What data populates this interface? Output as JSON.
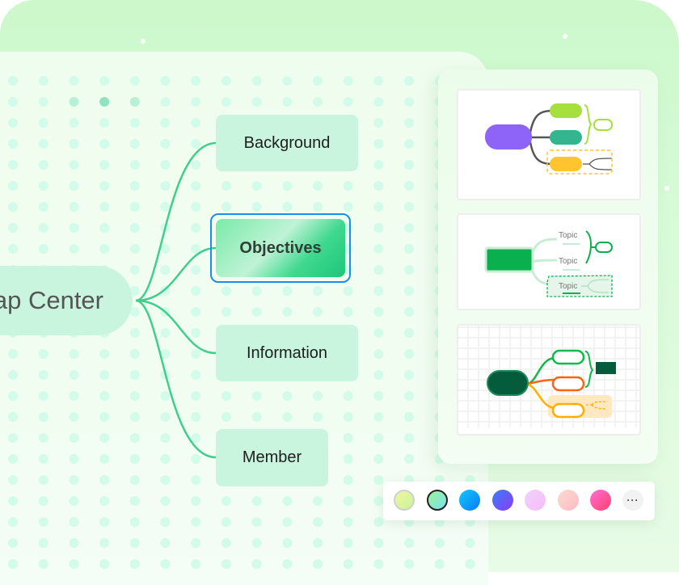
{
  "mindmap": {
    "center_label": "Map Center",
    "center_visible_text": "ap Center",
    "branches": [
      {
        "label": "Background",
        "selected": false
      },
      {
        "label": "Objectives",
        "selected": true
      },
      {
        "label": "Information",
        "selected": false
      },
      {
        "label": "Member",
        "selected": false
      }
    ],
    "branch_line_color": "#3ecf8e",
    "selection_color": "#1a8fe8"
  },
  "style_panel": {
    "templates": [
      {
        "name": "template-colorful",
        "root_color": "#8e63f7",
        "topic_colors": [
          "#a6e03f",
          "#33b68f",
          "#ffc42e"
        ]
      },
      {
        "name": "template-green",
        "root_color": "#0ab04e",
        "topic_labels": [
          "Topic",
          "Topic",
          "Topic"
        ]
      },
      {
        "name": "template-grid",
        "root_color": "#045c3c",
        "topic_colors": [
          "#10b94a",
          "#ff6412",
          "#ffae00"
        ]
      }
    ]
  },
  "palette": {
    "swatches": [
      {
        "name": "lime",
        "from": "#f3f59b",
        "to": "#c4f59c",
        "selected": false
      },
      {
        "name": "mint",
        "from": "#9af598",
        "to": "#7be0f2",
        "selected": true
      },
      {
        "name": "sky",
        "from": "#10c8ff",
        "to": "#0a7bf5",
        "selected": false
      },
      {
        "name": "indigo",
        "from": "#3b7ef7",
        "to": "#8a3cf7",
        "selected": false
      },
      {
        "name": "lavender",
        "from": "#efd2fb",
        "to": "#f6bdf9",
        "selected": false
      },
      {
        "name": "peach",
        "from": "#fcd9d0",
        "to": "#fbbcc4",
        "selected": false
      },
      {
        "name": "pink",
        "from": "#ff70d8",
        "to": "#ff3f6b",
        "selected": false
      }
    ],
    "more_label": "···"
  }
}
